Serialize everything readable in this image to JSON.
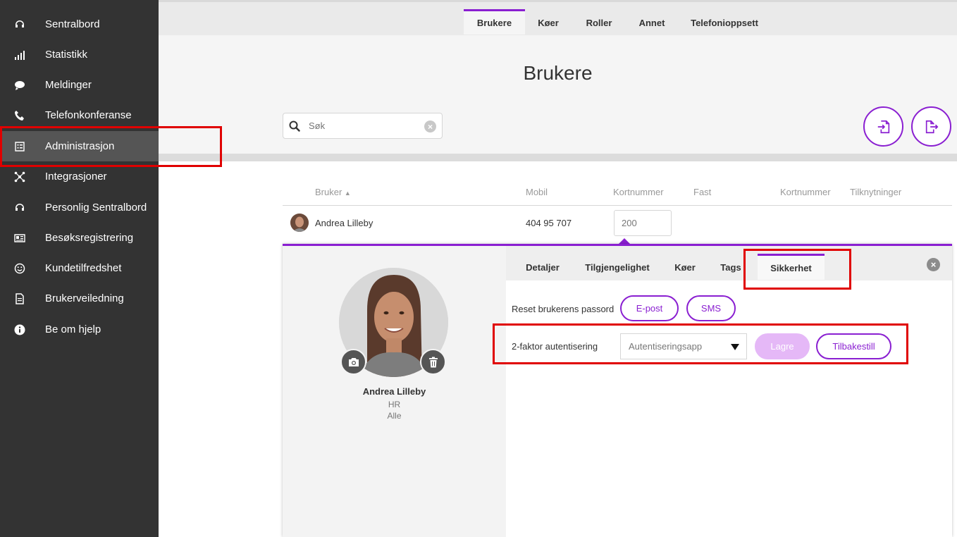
{
  "sidebar": {
    "items": [
      {
        "label": "Sentralbord",
        "icon": "headset-icon"
      },
      {
        "label": "Statistikk",
        "icon": "bar-chart-icon"
      },
      {
        "label": "Meldinger",
        "icon": "chat-bubble-icon"
      },
      {
        "label": "Telefonkonferanse",
        "icon": "phone-icon"
      },
      {
        "label": "Administrasjon",
        "icon": "admin-checklist-icon"
      },
      {
        "label": "Integrasjoner",
        "icon": "integrations-icon"
      },
      {
        "label": "Personlig Sentralbord",
        "icon": "headset-icon"
      },
      {
        "label": "Besøksregistrering",
        "icon": "id-card-icon"
      },
      {
        "label": "Kundetilfredshet",
        "icon": "smiley-icon"
      },
      {
        "label": "Brukerveiledning",
        "icon": "document-icon"
      },
      {
        "label": "Be om hjelp",
        "icon": "info-icon"
      }
    ],
    "active": "Administrasjon"
  },
  "top_tabs": [
    "Brukere",
    "Køer",
    "Roller",
    "Annet",
    "Telefonioppsett"
  ],
  "page": {
    "title": "Brukere",
    "search_placeholder": "Søk"
  },
  "table": {
    "columns": [
      "Bruker",
      "Mobil",
      "Kortnummer",
      "Fast",
      "Kortnummer",
      "Tilknytninger"
    ],
    "sort_indicator": "▲",
    "rows": [
      {
        "name": "Andrea Lilleby",
        "mobile": "404 95 707",
        "short_number": "200"
      }
    ]
  },
  "detail": {
    "name": "Andrea Lilleby",
    "department": "HR",
    "group": "Alle",
    "tabs": [
      "Detaljer",
      "Tilgjengelighet",
      "Køer",
      "Tags",
      "Sikkerhet"
    ],
    "active_tab": "Sikkerhet",
    "security": {
      "reset_label": "Reset brukerens passord",
      "email_button": "E-post",
      "sms_button": "SMS",
      "twofa_label": "2-faktor autentisering",
      "twofa_value": "Autentiseringsapp",
      "save_button": "Lagre",
      "reset_button": "Tilbakestill"
    }
  },
  "colors": {
    "accent": "#8a1fd1",
    "sidebar_bg": "#333333",
    "highlight": "#e00000"
  }
}
